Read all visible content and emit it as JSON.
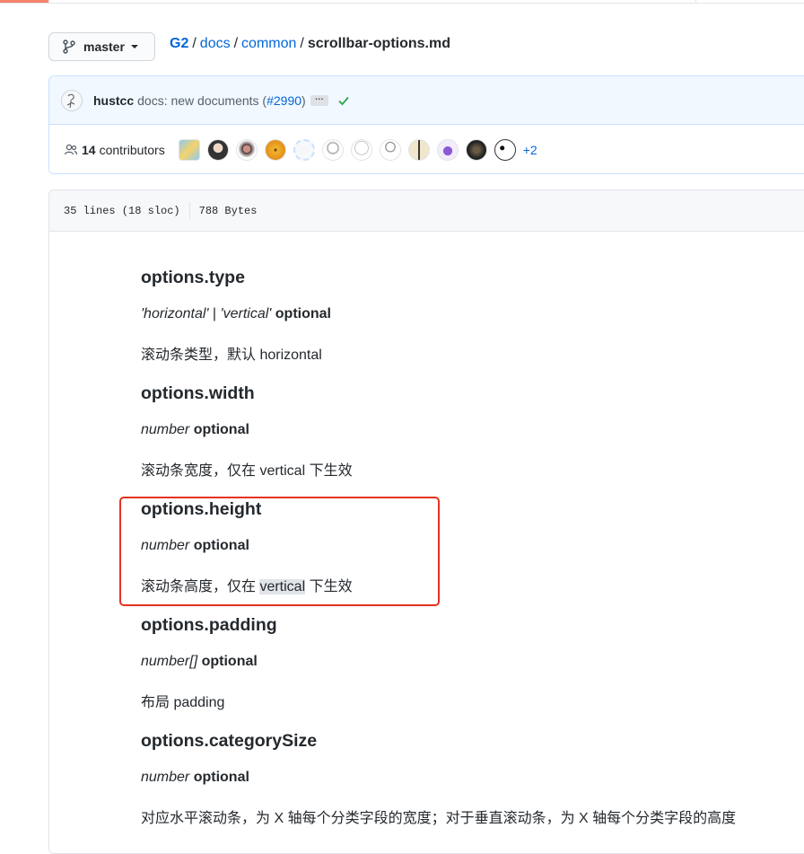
{
  "branch": {
    "label": "master"
  },
  "breadcrumb": {
    "repo": "G2",
    "segments": [
      "docs",
      "common"
    ],
    "file": "scrollbar-options.md",
    "separator": "/"
  },
  "commit": {
    "author": "hustcc",
    "message_prefix": "docs: new documents (",
    "pr_link": "#2990",
    "message_suffix": ")",
    "ellipsis": "…"
  },
  "contributors": {
    "count": "14",
    "label": "contributors",
    "more": "+2"
  },
  "file_info": {
    "lines": "35 lines (18 sloc)",
    "size": "788 Bytes"
  },
  "doc": {
    "s1": {
      "heading": "options.type",
      "type_a": "'horizontal'",
      "pipe": " | ",
      "type_b": "'vertical'",
      "opt": "optional",
      "desc": "滚动条类型，默认 horizontal"
    },
    "s2": {
      "heading": "options.width",
      "type": "number",
      "opt": "optional",
      "desc": "滚动条宽度，仅在 vertical 下生效"
    },
    "s3": {
      "heading": "options.height",
      "type": "number",
      "opt": "optional",
      "desc_a": "滚动条高度，仅在 ",
      "desc_hl": "vertical",
      "desc_b": " 下生效"
    },
    "s4": {
      "heading": "options.padding",
      "type": "number[]",
      "opt": "optional",
      "desc": "布局 padding"
    },
    "s5": {
      "heading": "options.categorySize",
      "type": "number",
      "opt": "optional",
      "desc": "对应水平滚动条，为 X 轴每个分类字段的宽度；对于垂直滚动条，为 X 轴每个分类字段的高度"
    }
  },
  "colors": {
    "link": "#0366d6",
    "annotation_red": "#e5321f",
    "commit_bg": "#f1f8ff",
    "check": "#28a745"
  }
}
